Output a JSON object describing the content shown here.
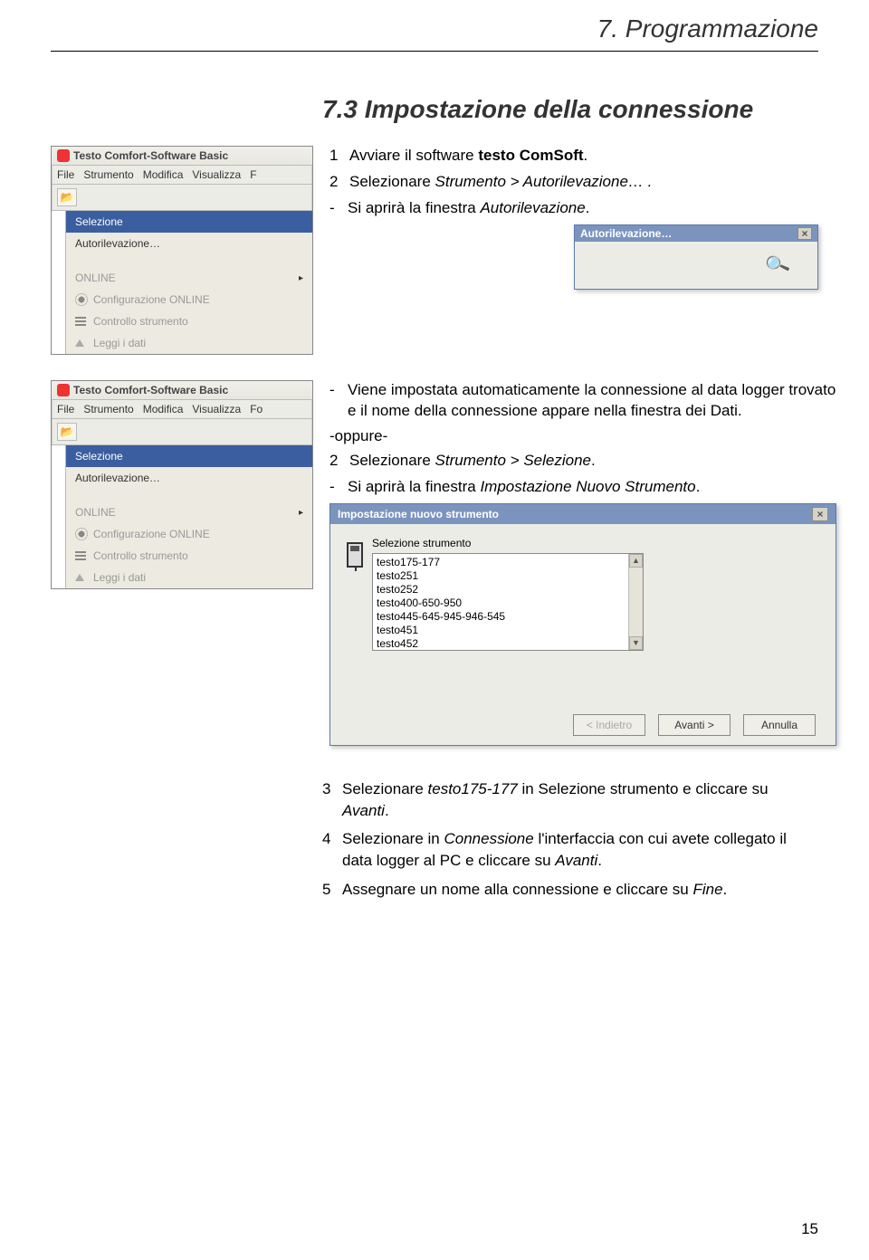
{
  "page": {
    "header": "7. Programmazione",
    "section_title": "7.3 Impostazione della connessione",
    "page_number": "15"
  },
  "steps_a": {
    "n1": "1",
    "t1_pre": "Avviare il software ",
    "t1_bold": "testo ComSoft",
    "t1_post": ".",
    "n2": "2",
    "t2_pre": "Selezionare ",
    "t2_it": "Strumento > Autorilevazione… .",
    "d1_pre": "Si aprirà la finestra ",
    "d1_it": "Autorilevazione",
    "d1_post": "."
  },
  "middle": {
    "d2": "Viene impostata automaticamente la connessione al data logger trovato e il nome della connessione appare nella finestra dei Dati.",
    "oppure": "-oppure-",
    "n2": "2",
    "m2_pre": "Selezionare ",
    "m2_it": "Strumento > Selezione",
    "m2_post": ".",
    "d3_pre": "Si aprirà la finestra ",
    "d3_it": "Impostazione Nuovo Strumento",
    "d3_post": "."
  },
  "app": {
    "title": "Testo Comfort-Software Basic",
    "menus": [
      "File",
      "Strumento",
      "Modifica",
      "Visualizza",
      "F"
    ],
    "menus2_last": "Fo",
    "items": {
      "selezione": "Selezione",
      "autorilevazione": "Autorilevazione…",
      "online": "ONLINE",
      "config": "Configurazione ONLINE",
      "controllo": "Controllo strumento",
      "leggi": "Leggi i dati"
    }
  },
  "auto_dialog": {
    "title": "Autorilevazione…"
  },
  "big_dialog": {
    "title": "Impostazione nuovo strumento",
    "group": "Selezione strumento",
    "options": [
      "testo175-177",
      "testo251",
      "testo252",
      "testo400-650-950",
      "testo445-645-945-946-545",
      "testo451",
      "testo452"
    ],
    "back": "< Indietro",
    "next": "Avanti >",
    "cancel": "Annulla"
  },
  "steps_b": {
    "n3": "3",
    "t3_pre": "Selezionare ",
    "t3_it1": "testo175-177",
    "t3_mid": " in Selezione strumento e cliccare su ",
    "t3_it2": "Avanti",
    "t3_post": ".",
    "n4": "4",
    "t4_pre": "Selezionare in ",
    "t4_it1": "Connessione",
    "t4_mid": " l'interfaccia con cui avete collegato il data logger al PC e cliccare su ",
    "t4_it2": "Avanti",
    "t4_post": ".",
    "n5": "5",
    "t5_pre": "Assegnare un nome alla connessione e cliccare su ",
    "t5_it": "Fine",
    "t5_post": "."
  }
}
